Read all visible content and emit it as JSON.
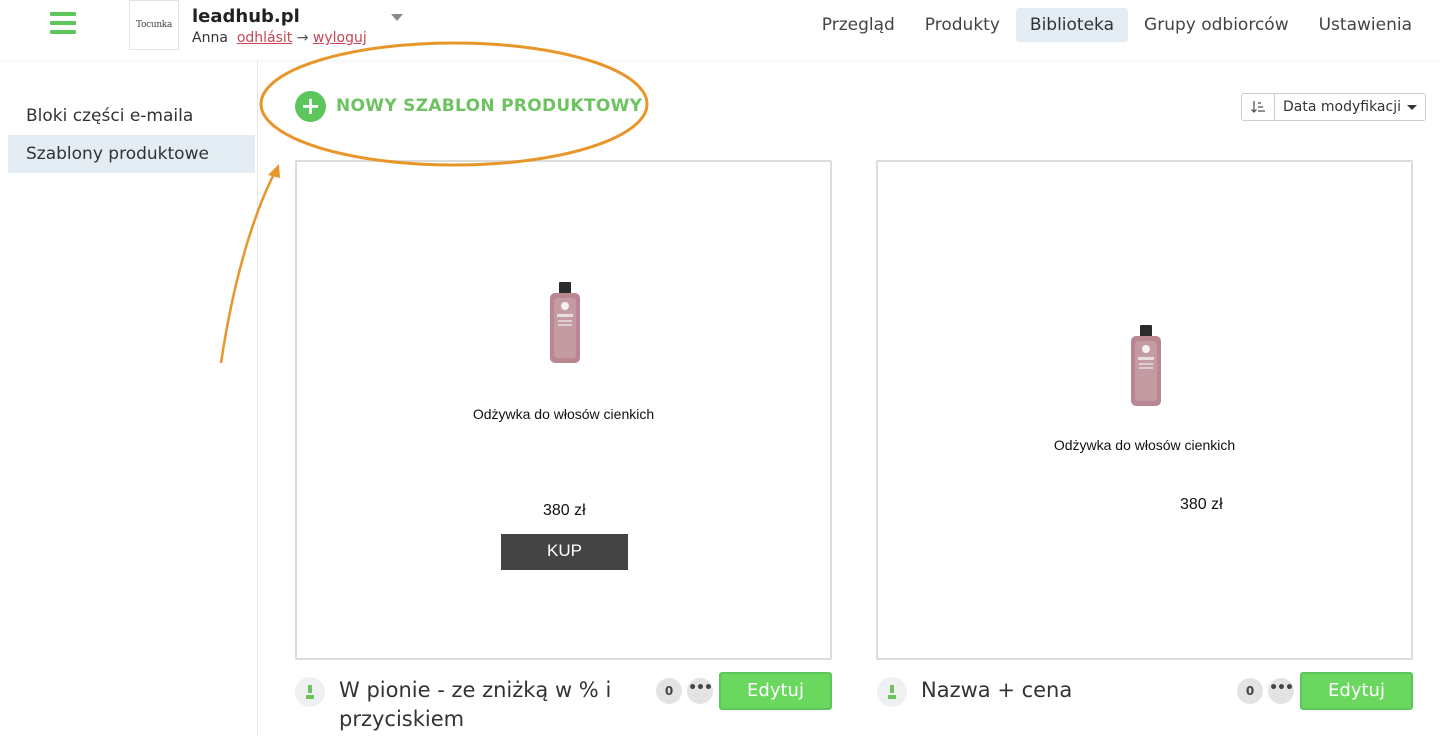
{
  "header": {
    "logo_text": "Tocunka",
    "site_name": "leadhub.pl",
    "user_name": "Anna",
    "logout_cz": "odhlásit",
    "arrow": "→",
    "logout_pl": "wyloguj",
    "nav": [
      {
        "label": "Przegląd",
        "active": false
      },
      {
        "label": "Produkty",
        "active": false
      },
      {
        "label": "Biblioteka",
        "active": true
      },
      {
        "label": "Grupy odbiorców",
        "active": false
      },
      {
        "label": "Ustawienia",
        "active": false
      }
    ]
  },
  "sidebar": {
    "items": [
      {
        "label": "Bloki części e-maila",
        "active": false
      },
      {
        "label": "Szablony produktowe",
        "active": true
      }
    ]
  },
  "toolbar": {
    "new_template_label": "NOWY SZABLON PRODUKTOWY",
    "plus_symbol": "+",
    "sort_label": "Data modyfikacji"
  },
  "templates": [
    {
      "product_name": "Odżywka do włosów cienkich",
      "price": "380 zł",
      "buy_label": "KUP",
      "title": "W pionie - ze zniżką w % i przyciskiem",
      "count": "0",
      "more": "•••",
      "edit_label": "Edytuj"
    },
    {
      "product_name": "Odżywka do włosów cienkich",
      "price": "380 zł",
      "title": "Nazwa + cena",
      "count": "0",
      "more": "•••",
      "edit_label": "Edytuj"
    }
  ],
  "colors": {
    "brand_green": "#5cc65c",
    "link_red": "#c74554",
    "annotation_orange": "#e8952a",
    "active_bg": "#e4edf3"
  }
}
